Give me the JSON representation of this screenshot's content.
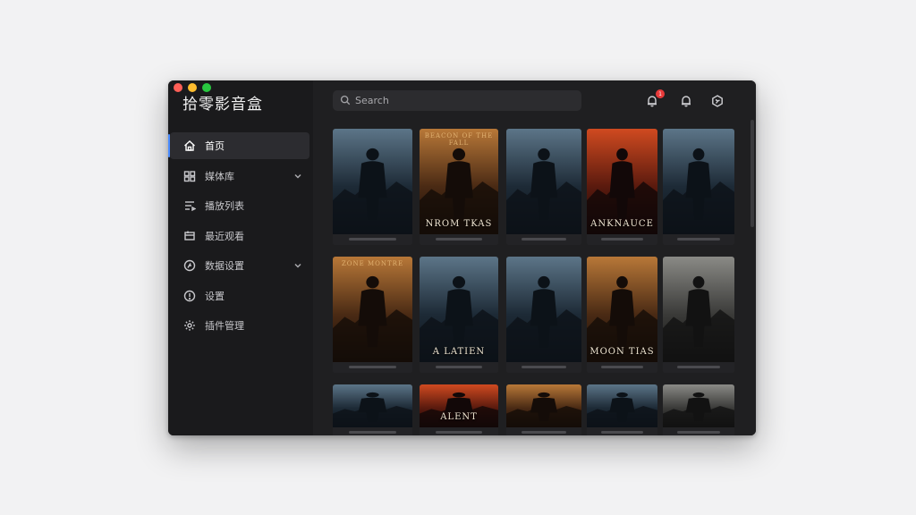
{
  "app": {
    "title": "拾零影音盒"
  },
  "search": {
    "placeholder": "Search"
  },
  "notifications": {
    "badge": "1"
  },
  "sidebar": {
    "items": [
      {
        "label": "首页",
        "icon": "home-icon",
        "active": true,
        "expandable": false
      },
      {
        "label": "媒体库",
        "icon": "library-icon",
        "active": false,
        "expandable": true
      },
      {
        "label": "播放列表",
        "icon": "playlist-icon",
        "active": false,
        "expandable": false
      },
      {
        "label": "最近观看",
        "icon": "history-icon",
        "active": false,
        "expandable": false
      },
      {
        "label": "数据设置",
        "icon": "data-icon",
        "active": false,
        "expandable": true
      },
      {
        "label": "设置",
        "icon": "info-icon",
        "active": false,
        "expandable": false
      },
      {
        "label": "插件管理",
        "icon": "gear-icon",
        "active": false,
        "expandable": false
      }
    ]
  },
  "movies": [
    {
      "title": "",
      "top": "",
      "theme": "blue"
    },
    {
      "title": "NROM TKAS",
      "top": "BEACON OF THE FALL",
      "theme": "orange"
    },
    {
      "title": "",
      "top": "",
      "theme": "blue"
    },
    {
      "title": "ANKNAUCE",
      "top": "",
      "theme": "red"
    },
    {
      "title": "",
      "top": "",
      "theme": "blue"
    },
    {
      "title": "",
      "top": "ZONE MONTRE",
      "theme": "orange"
    },
    {
      "title": "A LATIEN",
      "top": "",
      "theme": "blue"
    },
    {
      "title": "",
      "top": "",
      "theme": "blue"
    },
    {
      "title": "MOON TIAS",
      "top": "",
      "theme": "orange"
    },
    {
      "title": "",
      "top": "",
      "theme": "grey"
    },
    {
      "title": "",
      "top": "",
      "theme": "blue"
    },
    {
      "title": "ALENT",
      "top": "",
      "theme": "red"
    },
    {
      "title": "",
      "top": "",
      "theme": "orange"
    },
    {
      "title": "",
      "top": "",
      "theme": "blue"
    },
    {
      "title": "",
      "top": "",
      "theme": "grey"
    }
  ],
  "colors": {
    "accent": "#4a8cff",
    "badge": "#e83a3a",
    "window": "#1c1c1e"
  }
}
